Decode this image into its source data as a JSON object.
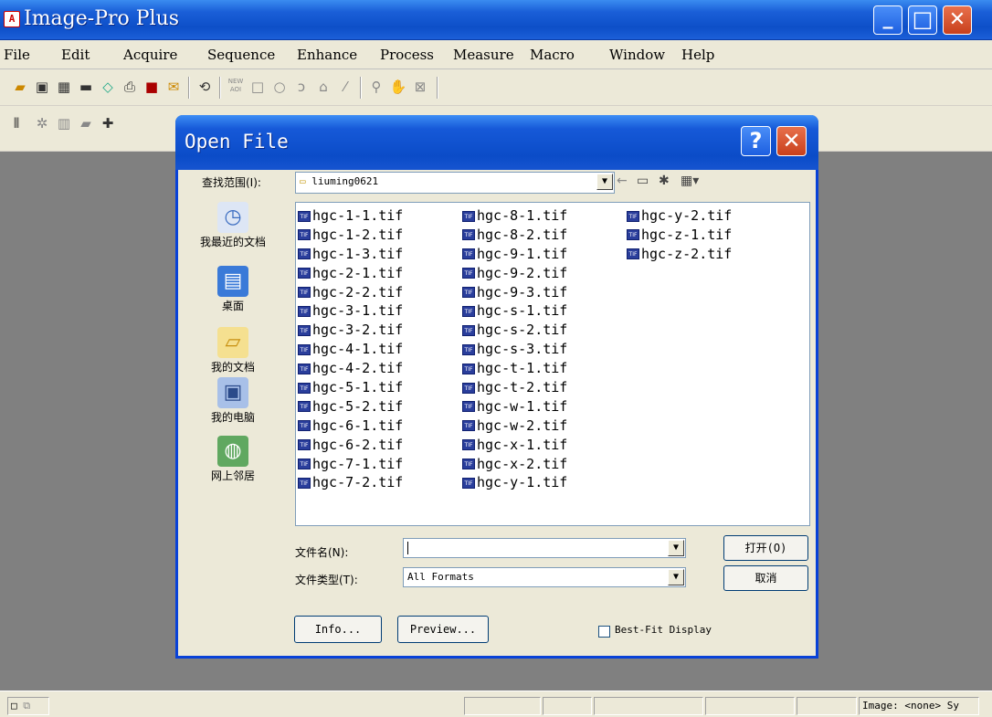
{
  "app": {
    "title": "Image-Pro Plus",
    "icon_char": "A"
  },
  "window_buttons": {
    "minimize": "_",
    "maximize": "□",
    "close": "✕"
  },
  "menu": [
    "File",
    "Edit",
    "Acquire",
    "Sequence",
    "Enhance",
    "Process",
    "Measure",
    "Macro",
    "Window",
    "Help"
  ],
  "toolbar1": {
    "new_aoi": "NEW\nAOI"
  },
  "dialog": {
    "title": "Open File",
    "help": "?",
    "close": "✕",
    "look_in_label": "查找范围(I):",
    "look_in_value": "liuming0621",
    "places": [
      "我最近的文档",
      "桌面",
      "我的文档",
      "我的电脑",
      "网上邻居"
    ],
    "files_col1": [
      "hgc-1-1.tif",
      "hgc-1-2.tif",
      "hgc-1-3.tif",
      "hgc-2-1.tif",
      "hgc-2-2.tif",
      "hgc-3-1.tif",
      "hgc-3-2.tif",
      "hgc-4-1.tif",
      "hgc-4-2.tif",
      "hgc-5-1.tif",
      "hgc-5-2.tif",
      "hgc-6-1.tif",
      "hgc-6-2.tif",
      "hgc-7-1.tif",
      "hgc-7-2.tif"
    ],
    "files_col2": [
      "hgc-8-1.tif",
      "hgc-8-2.tif",
      "hgc-9-1.tif",
      "hgc-9-2.tif",
      "hgc-9-3.tif",
      "hgc-s-1.tif",
      "hgc-s-2.tif",
      "hgc-s-3.tif",
      "hgc-t-1.tif",
      "hgc-t-2.tif",
      "hgc-w-1.tif",
      "hgc-w-2.tif",
      "hgc-x-1.tif",
      "hgc-x-2.tif",
      "hgc-y-1.tif"
    ],
    "files_col3": [
      "hgc-y-2.tif",
      "hgc-z-1.tif",
      "hgc-z-2.tif"
    ],
    "file_icon_text": "TIF",
    "filename_label": "文件名(N):",
    "filename_value": "",
    "filetype_label": "文件类型(T):",
    "filetype_value": "All Formats",
    "open_button": "打开(O)",
    "cancel_button": "取消",
    "info_button": "Info...",
    "preview_button": "Preview...",
    "bestfit_label": "Best-Fit Display",
    "bestfit_checked": false
  },
  "status": {
    "image_text": "Image: <none> Sy"
  }
}
